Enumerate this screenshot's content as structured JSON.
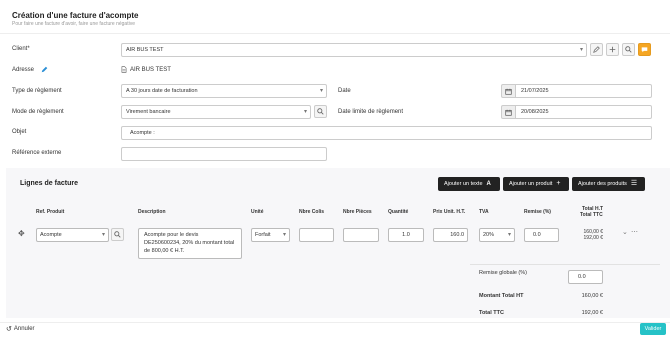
{
  "header": {
    "title": "Création d'une facture d'acompte",
    "subtitle": "Pour faire une facture d'avoir, faire une facture négative"
  },
  "form": {
    "client_label": "Client*",
    "client_value": "AIR BUS TEST",
    "adresse_label": "Adresse",
    "adresse_value": "AIR BUS TEST",
    "type_reglement_label": "Type de règlement",
    "type_reglement_value": "A 30 jours date de facturation",
    "mode_reglement_label": "Mode de règlement",
    "mode_reglement_value": "Virement bancaire",
    "objet_label": "Objet",
    "objet_value": "Acompte :",
    "reference_label": "Référence externe",
    "reference_value": "",
    "date_label": "Date",
    "date_value": "21/07/2025",
    "date_limite_label": "Date limite de règlement",
    "date_limite_value": "20/08/2025"
  },
  "lines": {
    "title": "Lignes de facture",
    "btn_texte": "Ajouter un texte",
    "btn_produit": "Ajouter un produit",
    "btn_produits": "Ajouter des produits",
    "columns": {
      "ref": "Ref. Produit",
      "description": "Description",
      "unite": "Unité",
      "colis": "Nbre Colis",
      "pieces": "Nbre Pièces",
      "quantite": "Quantité",
      "prix": "Prix Unit. H.T.",
      "tva": "TVA",
      "remise": "Remise (%)",
      "total_ht": "Total H.T",
      "total_ttc": "Total TTC"
    },
    "row": {
      "ref": "Acompte",
      "description": "Acompte pour le devis DE250600234, 20% du montant total de 800,00 € H.T.",
      "unite": "Forfait",
      "colis": "",
      "pieces": "",
      "quantite": "1.0",
      "prix": "160.0",
      "tva": "20%",
      "remise": "0.0",
      "total_ht": "160,00 €",
      "total_ttc": "192,00 €"
    }
  },
  "totals": {
    "remise_globale_label": "Remise globale (%)",
    "remise_globale_value": "0.0",
    "montant_ht_label": "Montant Total HT",
    "montant_ht_value": "160,00 €",
    "total_ttc_label": "Total TTC",
    "total_ttc_value": "192,00 €"
  },
  "footer": {
    "annuler": "Annuler",
    "valider": "Valider"
  },
  "colors": {
    "accent": "#26c2c7",
    "orange": "#f5a623",
    "dark": "#222222"
  }
}
